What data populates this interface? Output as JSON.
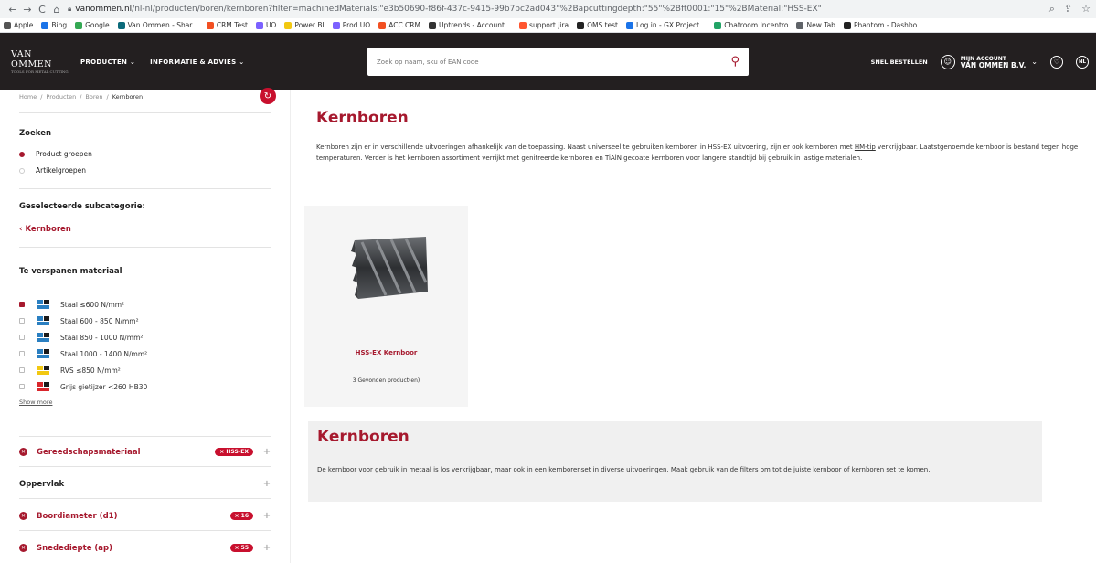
{
  "browser": {
    "url_domain": "vanommen.nl",
    "url_path": "/nl-nl/producten/boren/kernboren?filter=machinedMaterials:\"e3b50690-f86f-437c-9415-99b7bc2ad043\"%2Bapcuttingdepth:\"55\"%2Bft0001:\"15\"%2BMaterial:\"HSS-EX\"",
    "bookmarks": [
      {
        "label": "Apple",
        "color": "#555555"
      },
      {
        "label": "Bing",
        "color": "#1a73e8"
      },
      {
        "label": "Google",
        "color": "#34a853"
      },
      {
        "label": "Van Ommen - Shar...",
        "color": "#0b6a7a"
      },
      {
        "label": "CRM Test",
        "color": "#f25022"
      },
      {
        "label": "UO",
        "color": "#7b61ff"
      },
      {
        "label": "Power BI",
        "color": "#f2c811"
      },
      {
        "label": "Prod UO",
        "color": "#7b61ff"
      },
      {
        "label": "ACC CRM",
        "color": "#f25022"
      },
      {
        "label": "Uptrends - Account...",
        "color": "#333333"
      },
      {
        "label": "support jira",
        "color": "#ff5630"
      },
      {
        "label": "OMS test",
        "color": "#222222"
      },
      {
        "label": "Log in - GX Project...",
        "color": "#1a73e8"
      },
      {
        "label": "Chatroom Incentro",
        "color": "#21a366"
      },
      {
        "label": "New Tab",
        "color": "#5f6368"
      },
      {
        "label": "Phantom - Dashbo...",
        "color": "#222222"
      }
    ]
  },
  "header": {
    "logo": "VAN OMMEN",
    "logo_sub": "TOOLS FOR\nMETAL CUTTING",
    "nav": [
      "PRODUCTEN ⌄",
      "INFORMATIE & ADVIES ⌄"
    ],
    "search_placeholder": "Zoek op naam, sku of EAN code",
    "quick_order": "SNEL BESTELLEN",
    "account_line1": "MIJN ACCOUNT",
    "account_line2": "VAN OMMEN B.V.",
    "lang": "NL"
  },
  "sidebar": {
    "breadcrumb": [
      "Home",
      "/",
      "Producten",
      "/",
      "Boren",
      "/",
      "Kernboren"
    ],
    "search_title": "Zoeken",
    "radio_options": [
      {
        "label": "Product groepen",
        "selected": true
      },
      {
        "label": "Artikelgroepen",
        "selected": false
      }
    ],
    "subcategory_title": "Geselecteerde subcategorie:",
    "back_link": "Kernboren",
    "material_title": "Te verspanen materiaal",
    "materials": [
      {
        "label": "Staal ≤600 N/mm²",
        "checked": true,
        "color": "#2a7fc1"
      },
      {
        "label": "Staal 600 - 850 N/mm²",
        "checked": false,
        "color": "#2a7fc1"
      },
      {
        "label": "Staal 850 - 1000 N/mm²",
        "checked": false,
        "color": "#2a7fc1"
      },
      {
        "label": "Staal 1000 - 1400 N/mm²",
        "checked": false,
        "color": "#2a7fc1"
      },
      {
        "label": "RVS ≤850 N/mm²",
        "checked": false,
        "color": "#f2c811"
      },
      {
        "label": "Grijs gietijzer <260 HB30",
        "checked": false,
        "color": "#d9262c"
      }
    ],
    "show_more": "Show more",
    "facets": [
      {
        "label": "Gereedschapsmateriaal",
        "active": true,
        "chip": "× HSS-EX"
      },
      {
        "label": "Oppervlak",
        "active": false,
        "chip": ""
      },
      {
        "label": "Boordiameter (d1)",
        "active": true,
        "chip": "× 16"
      },
      {
        "label": "Snedediepte (ap)",
        "active": true,
        "chip": "× 55"
      }
    ]
  },
  "main": {
    "title": "Kernboren",
    "intro_part1": "Kernboren zijn er in verschillende uitvoeringen afhankelijk van de toepassing. Naast universeel te gebruiken kernboren in HSS-EX uitvoering, zijn er ook kernboren met ",
    "intro_link": "HM-tip",
    "intro_part2": " verkrijgbaar. Laatstgenoemde kernboor is bestand tegen hoge temperaturen. Verder is het kernboren assortiment verrijkt met genitreerde kernboren en TiAlN gecoate kernboren voor langere standtijd bij gebruik in lastige materialen.",
    "card": {
      "title": "HSS-EX Kernboor",
      "count": "3 Gevonden product(en)"
    },
    "info_title": "Kernboren",
    "info_part1": "De kernboor voor gebruik in metaal is los verkrijgbaar, maar ook in een ",
    "info_link": "kernborenset",
    "info_part2": " in diverse uitvoeringen. Maak gebruik van de filters om tot de juiste kernboor of kernboren set te komen."
  }
}
